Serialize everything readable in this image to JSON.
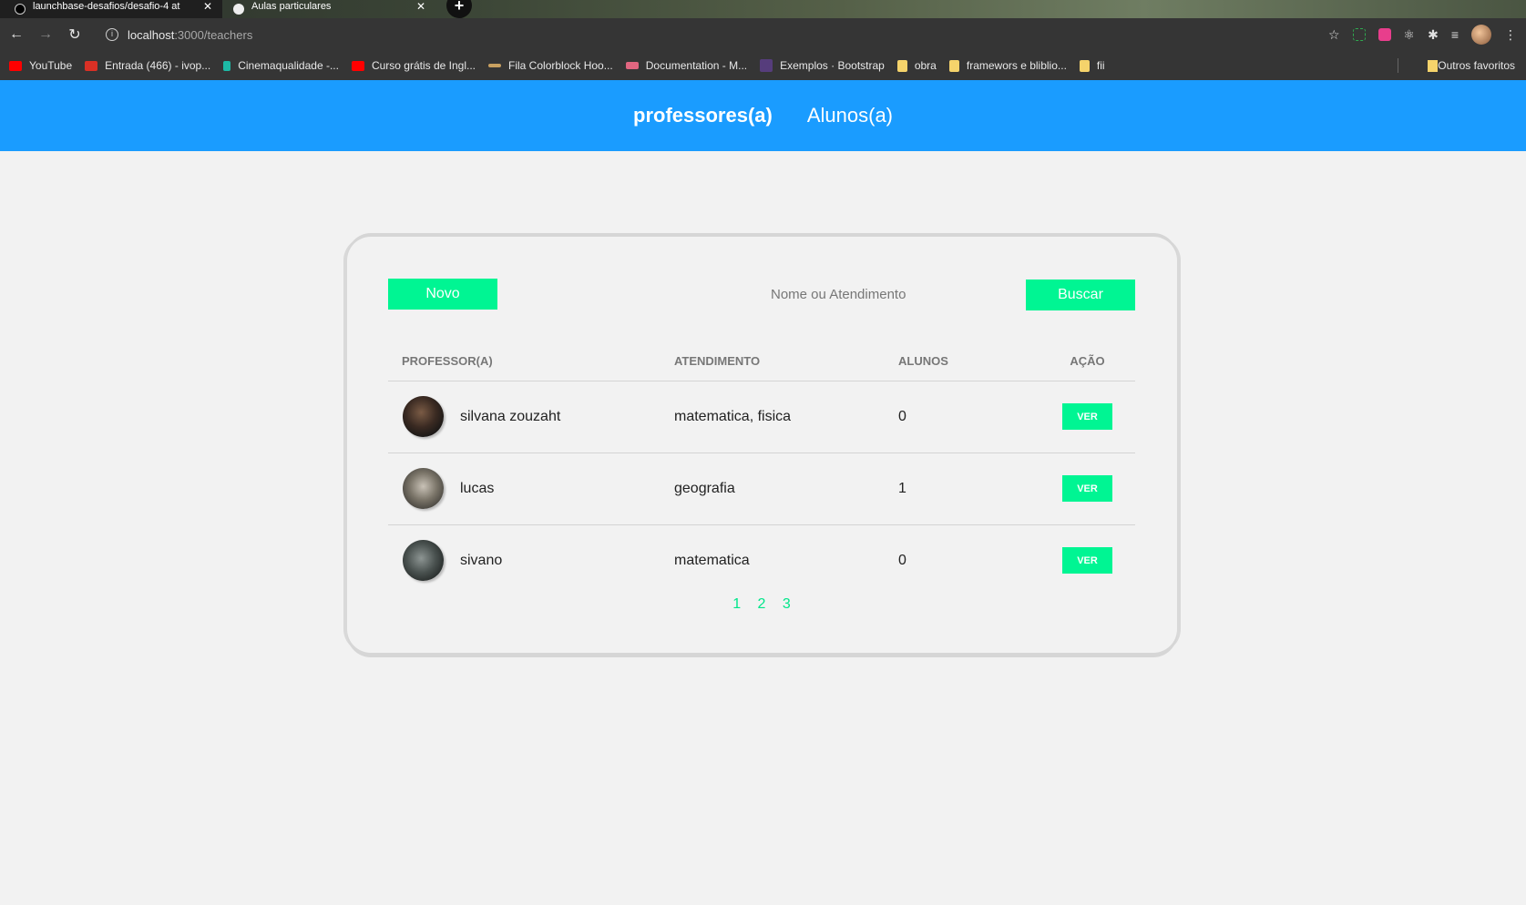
{
  "browser": {
    "tabs": [
      {
        "title": "launchbase-desafios/desafio-4 at",
        "close": "✕"
      },
      {
        "title": "Aulas particulares",
        "close": "✕"
      }
    ],
    "new_tab": "+",
    "url_host": "localhost",
    "url_path": ":3000/teachers",
    "bookmarks": [
      {
        "label": "YouTube",
        "color": "#ff0000"
      },
      {
        "label": "Entrada (466) - ivop...",
        "color": "#d93025"
      },
      {
        "label": "Cinemaqualidade -...",
        "color": "#1db9a5"
      },
      {
        "label": "Curso grátis de Ingl...",
        "color": "#ff0000"
      },
      {
        "label": "Fila Colorblock Hoo...",
        "color": "#c8a060"
      },
      {
        "label": "Documentation - M...",
        "color": "#e06680"
      },
      {
        "label": "Exemplos · Bootstrap",
        "color": "#563d7c"
      },
      {
        "label": "obra",
        "color": "#f5d36b"
      },
      {
        "label": "framewors e bliblio...",
        "color": "#f5d36b"
      },
      {
        "label": "fii",
        "color": "#f5d36b"
      }
    ],
    "other_bookmarks": "Outros favoritos"
  },
  "header": {
    "nav": [
      {
        "label": "professores(a)",
        "active": true
      },
      {
        "label": "Alunos(a)",
        "active": false
      }
    ]
  },
  "actions": {
    "new_label": "Novo",
    "search_placeholder": "Nome ou Atendimento",
    "search_label": "Buscar"
  },
  "table": {
    "headers": [
      "PROFESSOR(A)",
      "ATENDIMENTO",
      "ALUNOS",
      "AÇÃO"
    ],
    "rows": [
      {
        "name": "silvana zouzaht",
        "services": "matematica, fisica",
        "students": "0",
        "action": "VER"
      },
      {
        "name": "lucas",
        "services": "geografia",
        "students": "1",
        "action": "VER"
      },
      {
        "name": "sivano",
        "services": "matematica",
        "students": "0",
        "action": "VER"
      }
    ]
  },
  "pagination": [
    "1",
    "2",
    "3"
  ],
  "colors": {
    "header": "#1a9cff",
    "accent": "#00f593",
    "background": "#f2f2f2"
  }
}
